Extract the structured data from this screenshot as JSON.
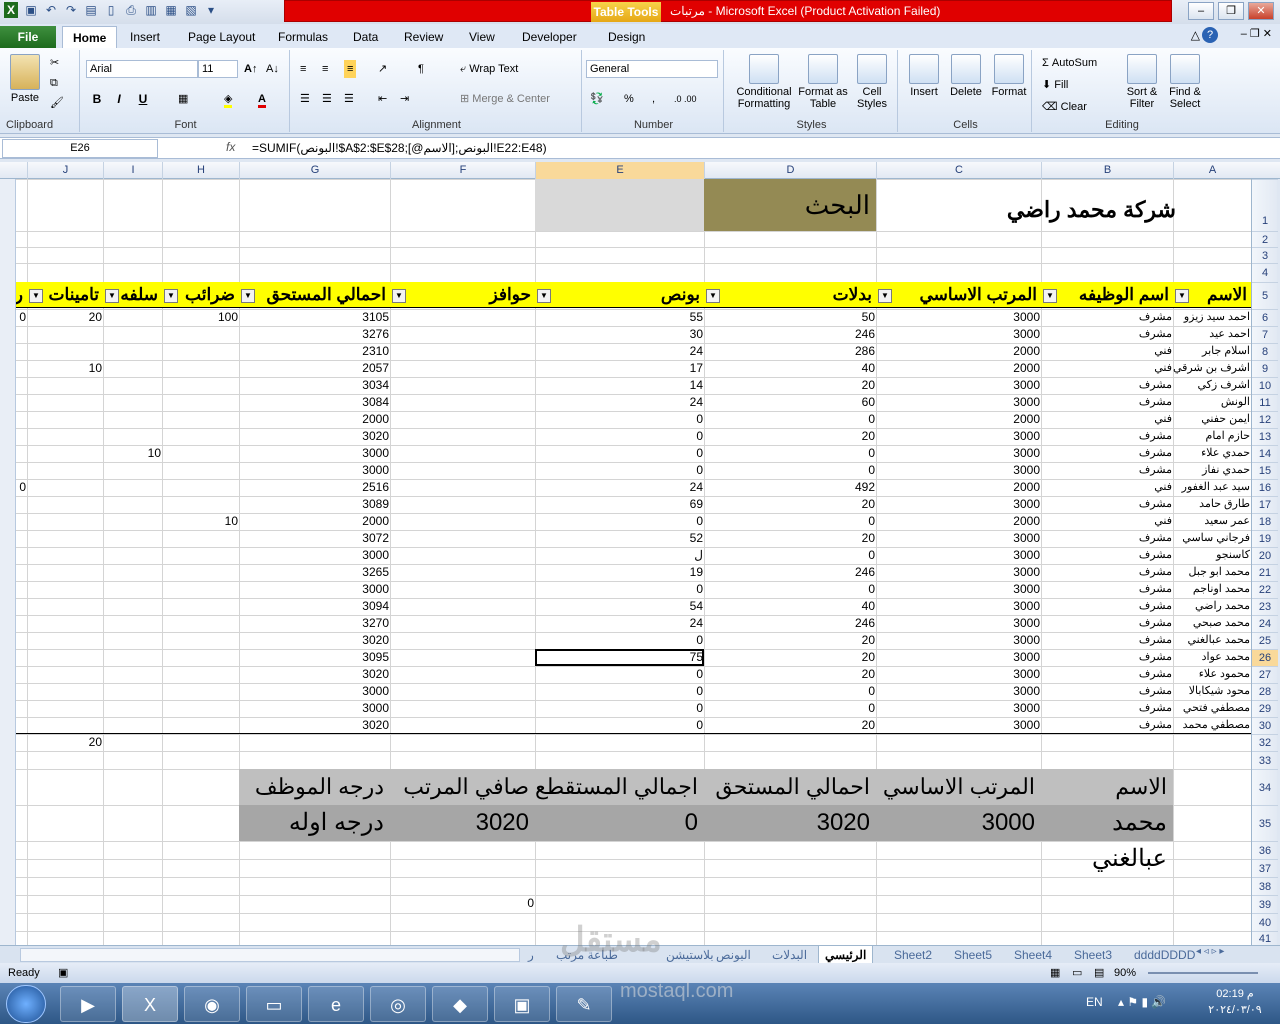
{
  "title": {
    "app_title": "Microsoft Excel (Product Activation Failed)",
    "file_name": "مرتبات",
    "table_tools": "Table Tools"
  },
  "ribbon_tabs": [
    "File",
    "Home",
    "Insert",
    "Page Layout",
    "Formulas",
    "Data",
    "Review",
    "View",
    "Developer",
    "Design"
  ],
  "ribbon": {
    "clipboard": {
      "label": "Clipboard",
      "paste": "Paste"
    },
    "font": {
      "label": "Font",
      "name": "Arial",
      "size": "11",
      "bold": "B",
      "italic": "I",
      "underline": "U"
    },
    "alignment": {
      "label": "Alignment",
      "wrap": "Wrap Text",
      "merge": "Merge & Center"
    },
    "number": {
      "label": "Number",
      "format": "General",
      "percent": "%",
      "comma": ","
    },
    "styles": {
      "label": "Styles",
      "cond": "Conditional Formatting",
      "table": "Format as Table",
      "cell": "Cell Styles"
    },
    "cells": {
      "label": "Cells",
      "insert": "Insert",
      "delete": "Delete",
      "format": "Format"
    },
    "editing": {
      "label": "Editing",
      "autosum": "AutoSum",
      "fill": "Fill",
      "clear": "Clear",
      "sort": "Sort & Filter",
      "find": "Find & Select"
    }
  },
  "formula_bar": {
    "name_box": "E26",
    "fx": "fx",
    "formula": "=SUMIF(البونص!$A$2:$E$28;[@الاسم];البونص!E22:E48)"
  },
  "columns": [
    "J",
    "I",
    "H",
    "G",
    "F",
    "E",
    "D",
    "C",
    "B",
    "A"
  ],
  "rows": [
    "1",
    "2",
    "3",
    "4",
    "5",
    "6",
    "7",
    "8",
    "9",
    "10",
    "11",
    "12",
    "13",
    "14",
    "15",
    "16",
    "17",
    "18",
    "19",
    "20",
    "21",
    "22",
    "23",
    "24",
    "25",
    "26",
    "27",
    "28",
    "29",
    "30",
    "32",
    "33",
    "34",
    "35",
    "36",
    "37",
    "38",
    "39",
    "40",
    "41"
  ],
  "sheet": {
    "company": "شركة محمد راضي",
    "search": "البحث",
    "headers": {
      "name": "الاسم",
      "job": "اسم الوظيفه",
      "base": "المرتب الاساسي",
      "allow": "بدلات",
      "bonus": "بونص",
      "incent": "حوافز",
      "total": "احمالي المستحق",
      "tax": "ضرائب",
      "loan": "سلفه",
      "insur": "تامينات",
      "extra": "ر"
    },
    "rows": [
      {
        "name": "احمد سيد زيزو",
        "job": "مشرف",
        "base": "3000",
        "allow": "50",
        "bonus": "55",
        "total": "3105",
        "tax": "100",
        "loan": "",
        "insur": "20",
        "k": "0"
      },
      {
        "name": "احمد عيد",
        "job": "مشرف",
        "base": "3000",
        "allow": "246",
        "bonus": "30",
        "total": "3276",
        "tax": "",
        "loan": "",
        "insur": "",
        "k": ""
      },
      {
        "name": "اسلام جابر",
        "job": "فني",
        "base": "2000",
        "allow": "286",
        "bonus": "24",
        "total": "2310",
        "tax": "",
        "loan": "",
        "insur": "",
        "k": ""
      },
      {
        "name": "اشرف بن شرقي",
        "job": "فني",
        "base": "2000",
        "allow": "40",
        "bonus": "17",
        "total": "2057",
        "tax": "",
        "loan": "",
        "insur": "10",
        "k": ""
      },
      {
        "name": "اشرف زكي",
        "job": "مشرف",
        "base": "3000",
        "allow": "20",
        "bonus": "14",
        "total": "3034",
        "tax": "",
        "loan": "",
        "insur": "",
        "k": ""
      },
      {
        "name": "الونش",
        "job": "مشرف",
        "base": "3000",
        "allow": "60",
        "bonus": "24",
        "total": "3084",
        "tax": "",
        "loan": "",
        "insur": "",
        "k": ""
      },
      {
        "name": "ايمن حفني",
        "job": "فني",
        "base": "2000",
        "allow": "0",
        "bonus": "0",
        "total": "2000",
        "tax": "",
        "loan": "",
        "insur": "",
        "k": ""
      },
      {
        "name": "حازم امام",
        "job": "مشرف",
        "base": "3000",
        "allow": "20",
        "bonus": "0",
        "total": "3020",
        "tax": "",
        "loan": "",
        "insur": "",
        "k": ""
      },
      {
        "name": "حمدي علاء",
        "job": "مشرف",
        "base": "3000",
        "allow": "0",
        "bonus": "0",
        "total": "3000",
        "tax": "",
        "loan": "10",
        "insur": "",
        "k": ""
      },
      {
        "name": "حمدي نفاز",
        "job": "مشرف",
        "base": "3000",
        "allow": "0",
        "bonus": "0",
        "total": "3000",
        "tax": "",
        "loan": "",
        "insur": "",
        "k": ""
      },
      {
        "name": "سيد عبد الغفور",
        "job": "فني",
        "base": "2000",
        "allow": "492",
        "bonus": "24",
        "total": "2516",
        "tax": "",
        "loan": "",
        "insur": "",
        "k": "0"
      },
      {
        "name": "طارق حامد",
        "job": "مشرف",
        "base": "3000",
        "allow": "20",
        "bonus": "69",
        "total": "3089",
        "tax": "",
        "loan": "",
        "insur": "",
        "k": ""
      },
      {
        "name": "عمر سعيد",
        "job": "فني",
        "base": "2000",
        "allow": "0",
        "bonus": "0",
        "total": "2000",
        "tax": "10",
        "loan": "",
        "insur": "",
        "k": ""
      },
      {
        "name": "فرجاني ساسي",
        "job": "مشرف",
        "base": "3000",
        "allow": "20",
        "bonus": "52",
        "total": "3072",
        "tax": "",
        "loan": "",
        "insur": "",
        "k": ""
      },
      {
        "name": "كاسنجو",
        "job": "مشرف",
        "base": "3000",
        "allow": "0",
        "bonus": "ل",
        "total": "3000",
        "tax": "",
        "loan": "",
        "insur": "",
        "k": ""
      },
      {
        "name": "محمد ابو جبل",
        "job": "مشرف",
        "base": "3000",
        "allow": "246",
        "bonus": "19",
        "total": "3265",
        "tax": "",
        "loan": "",
        "insur": "",
        "k": ""
      },
      {
        "name": "محمد اوناجم",
        "job": "مشرف",
        "base": "3000",
        "allow": "0",
        "bonus": "0",
        "total": "3000",
        "tax": "",
        "loan": "",
        "insur": "",
        "k": ""
      },
      {
        "name": "محمد راضي",
        "job": "مشرف",
        "base": "3000",
        "allow": "40",
        "bonus": "54",
        "total": "3094",
        "tax": "",
        "loan": "",
        "insur": "",
        "k": ""
      },
      {
        "name": "محمد صبحي",
        "job": "مشرف",
        "base": "3000",
        "allow": "246",
        "bonus": "24",
        "total": "3270",
        "tax": "",
        "loan": "",
        "insur": "",
        "k": ""
      },
      {
        "name": "محمد عبالغني",
        "job": "مشرف",
        "base": "3000",
        "allow": "20",
        "bonus": "0",
        "total": "3020",
        "tax": "",
        "loan": "",
        "insur": "",
        "k": ""
      },
      {
        "name": "محمد عواد",
        "job": "مشرف",
        "base": "3000",
        "allow": "20",
        "bonus": "75",
        "total": "3095",
        "tax": "",
        "loan": "",
        "insur": "",
        "k": ""
      },
      {
        "name": "محمود علاء",
        "job": "مشرف",
        "base": "3000",
        "allow": "20",
        "bonus": "0",
        "total": "3020",
        "tax": "",
        "loan": "",
        "insur": "",
        "k": ""
      },
      {
        "name": "محود شيكابالا",
        "job": "مشرف",
        "base": "3000",
        "allow": "0",
        "bonus": "0",
        "total": "3000",
        "tax": "",
        "loan": "",
        "insur": "",
        "k": ""
      },
      {
        "name": "مصطفي فتحي",
        "job": "مشرف",
        "base": "3000",
        "allow": "0",
        "bonus": "0",
        "total": "3000",
        "tax": "",
        "loan": "",
        "insur": "",
        "k": ""
      },
      {
        "name": "مصطفي محمد",
        "job": "مشرف",
        "base": "3000",
        "allow": "20",
        "bonus": "0",
        "total": "3020",
        "tax": "",
        "loan": "",
        "insur": "",
        "k": ""
      }
    ],
    "row32_insur": "20",
    "summary": {
      "headers": [
        "الاسم",
        "المرتب الاساسي",
        "احمالي المستحق",
        "اجمالي المستقطع",
        "صافي المرتب",
        "درجه الموظف"
      ],
      "values": [
        "محمد عبالغني",
        "3000",
        "3020",
        "0",
        "3020",
        "درجه اوله"
      ]
    },
    "f39": "0"
  },
  "sheet_tabs": [
    "ddddDDDD",
    "Sheet3",
    "Sheet4",
    "Sheet5",
    "Sheet2",
    "الرئيسي",
    "البدلات",
    "البونص",
    "بلاستيشن",
    "طباعة مرتب",
    "ر"
  ],
  "status": {
    "ready": "Ready",
    "zoom": "90%"
  },
  "taskbar": {
    "lang": "EN",
    "time": "02:19 م",
    "date": "٢٠٢٤/٠٣/٠٩"
  },
  "watermark": "mostaql.com",
  "colors": {
    "header_yellow": "#ffff00",
    "search_fill": "#948a54",
    "summary_head": "#bfbfbf",
    "summary_val": "#a6a6a6",
    "title_red": "#e00000"
  }
}
